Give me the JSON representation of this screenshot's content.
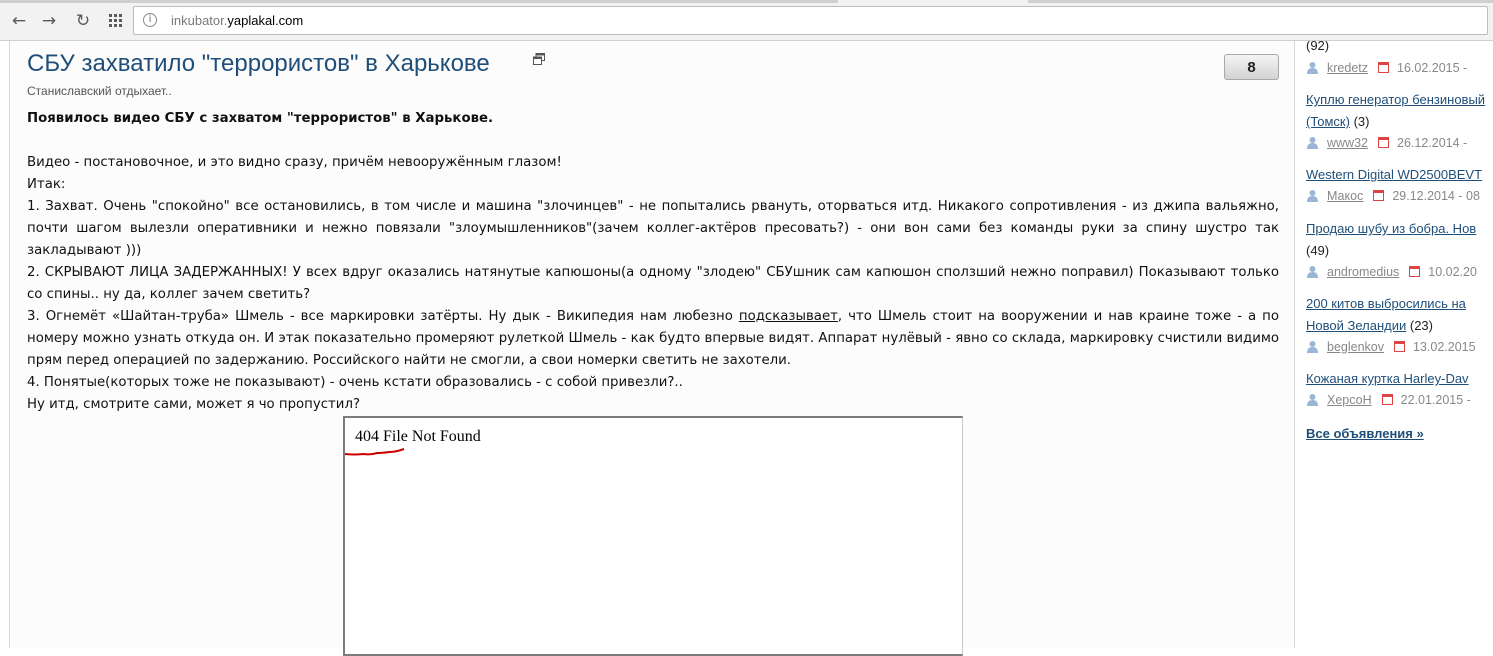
{
  "browser": {
    "url_host_prefix": "inkubator.",
    "url_host_main": "yaplakal.com"
  },
  "article": {
    "title": "СБУ захватило \"террористов\" в Харькове",
    "rating": "8",
    "subtitle": "Станиславский отдыхает..",
    "headline": "Появилось видео СБУ с захватом \"террористов\" в Харькове.",
    "p_intro": "Видео - постановочное, и это видно сразу, причём невооружённым глазом!",
    "p_itak": "Итак:",
    "p_1": "1. Захват. Очень \"спокойно\" все остановились, в том числе и машина \"злочинцев\" - не попытались рвануть, оторваться итд. Никакого сопротивления - из джипа вальяжно, почти шагом вылезли оперативники и нежно повязали \"злоумышленников\"(зачем коллег-актёров пресовать?) - они вон сами без команды руки за спину шустро так закладывают )))",
    "p_2": "2. СКРЫВАЮТ ЛИЦА ЗАДЕРЖАННЫХ! У всех вдруг оказались натянутые капюшоны(а одному \"злодею\" СБУшник сам капюшон сползший нежно поправил) Показывают только со спины.. ну да, коллег зачем светить?",
    "p_3_before": "3. Огнемёт «Шайтан-труба» Шмель - все маркировки затёрты. Ну дык - Википедия нам любезно ",
    "p_3_link": "подсказывает",
    "p_3_after": ", что Шмель стоит на вооружении и нав краине тоже - а по номеру можно узнать откуда он. И этак показательно промеряют рулеткой Шмель - как будто впервые видят. Аппарат нулёвый - явно со склада, маркировку счистили видимо прям перед операцией по задержанию. Российского найти не смогли, а свои номерки светить не захотели.",
    "p_4": "4. Понятые(которых тоже не показывают) - очень кстати образовались - с собой привезли?..",
    "p_end": "Ну итд, смотрите сами, может я чо пропустил?",
    "video_error": "404 File Not Found"
  },
  "sidebar": {
    "top_count": "(92)",
    "ads": [
      {
        "user": "kredetz",
        "date": "16.02.2015 -"
      },
      {
        "title_1": "Куплю генератор бензиновый",
        "title_2": "(Томск)",
        "count": "(3)",
        "user": "www32",
        "date": "26.12.2014 -"
      },
      {
        "title_1": "Western Digital WD2500BEVT",
        "user": "Макос",
        "date": "29.12.2014 - 08"
      },
      {
        "title_1": "Продаю шубу из бобра. Нов",
        "count": "(49)",
        "user": "andromedius",
        "date": "10.02.20"
      },
      {
        "title_1": "200 китов выбросились на",
        "title_2": "Новой Зеландии",
        "count": "(23)",
        "user": "beglenkov",
        "date": "13.02.2015"
      },
      {
        "title_1": "Кожаная куртка Harley-Dav",
        "user": "ХерсоН",
        "date": "22.01.2015 -"
      }
    ],
    "all_ads": "Все объявления »"
  },
  "colors": {
    "link": "#1f4e79",
    "underline_annotation": "#d00000"
  }
}
